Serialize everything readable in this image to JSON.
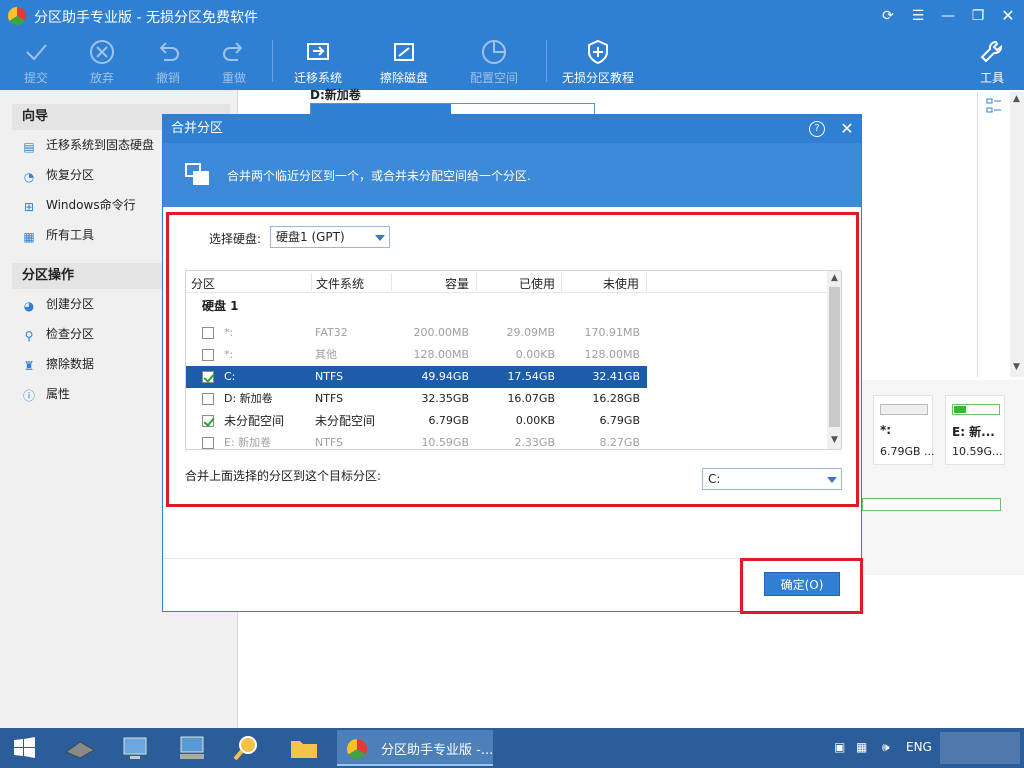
{
  "app": {
    "title": "分区助手专业版 - 无损分区免费软件"
  },
  "window_controls": [
    "refresh-icon",
    "menu-icon",
    "minimize-icon",
    "maximize-icon",
    "close-icon"
  ],
  "toolbar": {
    "commit": "提交",
    "discard": "放弃",
    "undo": "撤销",
    "redo": "重做",
    "migrate": "迁移系统",
    "wipe": "擦除磁盘",
    "allocate": "配置空间",
    "tutorial": "无损分区教程",
    "tools": "工具"
  },
  "sidebar": {
    "wizard_header": "向导",
    "wizard_items": [
      {
        "label": "迁移系统到固态硬盘",
        "icon": "migrate-icon"
      },
      {
        "label": "恢复分区",
        "icon": "recover-icon"
      },
      {
        "label": "Windows命令行",
        "icon": "windows-icon"
      },
      {
        "label": "所有工具",
        "icon": "tools-icon"
      }
    ],
    "ops_header": "分区操作",
    "ops_items": [
      {
        "label": "创建分区",
        "icon": "create-icon"
      },
      {
        "label": "检查分区",
        "icon": "check-icon"
      },
      {
        "label": "擦除数据",
        "icon": "wipe-icon"
      },
      {
        "label": "属性",
        "icon": "info-icon"
      }
    ]
  },
  "main": {
    "disk_label": "D:新加卷",
    "cards": [
      {
        "name": "*:",
        "size": "6.79GB ..."
      },
      {
        "name": "E: 新...",
        "size": "10.59G..."
      }
    ]
  },
  "dialog": {
    "title": "合并分区",
    "banner_text": "合并两个临近分区到一个，或合并未分配空间给一个分区.",
    "select_disk_label": "选择硬盘:",
    "select_disk_value": "硬盘1 (GPT)",
    "columns": [
      "分区",
      "文件系统",
      "容量",
      "已使用",
      "未使用"
    ],
    "group": "硬盘 1",
    "rows": [
      {
        "name": "*:",
        "fs": "FAT32",
        "cap": "200.00MB",
        "used": "29.09MB",
        "free": "170.91MB",
        "checked": false,
        "state": "dim"
      },
      {
        "name": "*:",
        "fs": "其他",
        "cap": "128.00MB",
        "used": "0.00KB",
        "free": "128.00MB",
        "checked": false,
        "state": "dim"
      },
      {
        "name": "C:",
        "fs": "NTFS",
        "cap": "49.94GB",
        "used": "17.54GB",
        "free": "32.41GB",
        "checked": true,
        "state": "selected"
      },
      {
        "name": "D: 新加卷",
        "fs": "NTFS",
        "cap": "32.35GB",
        "used": "16.07GB",
        "free": "16.28GB",
        "checked": false,
        "state": "normal"
      },
      {
        "name": "未分配空间",
        "fs": "未分配空间",
        "cap": "6.79GB",
        "used": "0.00KB",
        "free": "6.79GB",
        "checked": true,
        "state": "normal"
      },
      {
        "name": "E: 新加卷",
        "fs": "NTFS",
        "cap": "10.59GB",
        "used": "2.33GB",
        "free": "8.27GB",
        "checked": false,
        "state": "dim"
      }
    ],
    "target_label": "合并上面选择的分区到这个目标分区:",
    "target_value": "C:",
    "ok_label": "确定(O)"
  },
  "taskbar": {
    "active_app": "分区助手专业版 -...",
    "lang": "ENG"
  },
  "colors": {
    "accent": "#2f7fd3",
    "highlight": "#e01b24",
    "selected_row": "#1d5caa"
  }
}
